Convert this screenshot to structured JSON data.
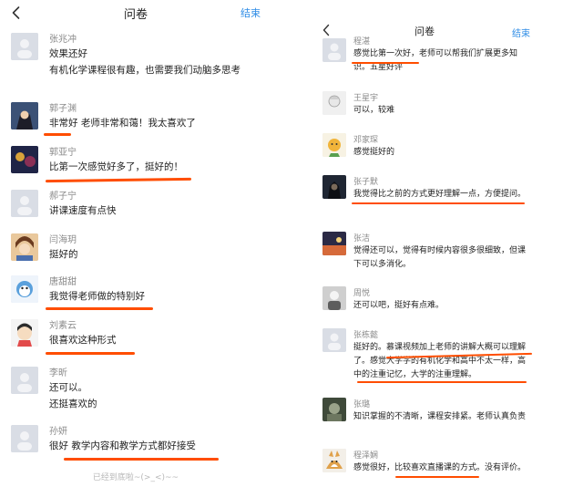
{
  "left": {
    "header": {
      "title": "问卷",
      "done": "结束"
    },
    "comments": [
      {
        "name": "张兆冲",
        "text": "效果还好\n有机化学课程很有趣，也需要我们动脑多思考"
      },
      {
        "name": "郭子渊",
        "text": "非常好  老师非常和蔼！我太喜欢了"
      },
      {
        "name": "郭亚宁",
        "text": "比第一次感觉好多了，挺好的！"
      },
      {
        "name": "郝子宁",
        "text": "讲课速度有点快"
      },
      {
        "name": "闫海玥",
        "text": "挺好的"
      },
      {
        "name": "唐甜甜",
        "text": "我觉得老师做的特别好"
      },
      {
        "name": "刘素云",
        "text": "很喜欢这种形式"
      },
      {
        "name": "李昕",
        "text": "还可以。\n还挺喜欢的"
      },
      {
        "name": "孙妍",
        "text": "很好  教学内容和教学方式都好接受"
      }
    ],
    "footer": "已经到底啦~(>_<)~~"
  },
  "right": {
    "header": {
      "title": "问卷",
      "done": "结束"
    },
    "comments": [
      {
        "name": "程湛",
        "text": "感觉比第一次好，老师可以帮我们扩展更多知识。五星好评"
      },
      {
        "name": "王星宇",
        "text": "可以，较难"
      },
      {
        "name": "邓家琛",
        "text": "感觉挺好的"
      },
      {
        "name": "张子默",
        "text": "我觉得比之前的方式更好理解一点，方便提问。"
      },
      {
        "name": "张洁",
        "text": "觉得还可以，觉得有时候内容很多很细致，但课下可以多消化。"
      },
      {
        "name": "周悦",
        "text": "还可以吧，挺好有点难。"
      },
      {
        "name": "张栋懿",
        "text": "挺好的。慕课视频加上老师的讲解大概可以理解了。感觉大学学的有机化学和高中不太一样，高中的注重记忆，大学的注重理解。"
      },
      {
        "name": "张璐",
        "text": "知识掌握的不清晰，课程安排紧。老师认真负责"
      },
      {
        "name": "程泽娴",
        "text": "感觉很好，比较喜欢直播课的方式。没有评价。"
      }
    ]
  },
  "colors": {
    "accent": "#2e8ce6",
    "underline": "#ff4d00",
    "name": "#8a8a8a",
    "text": "#222222"
  },
  "icons": {
    "back": "chevron-left-icon"
  }
}
